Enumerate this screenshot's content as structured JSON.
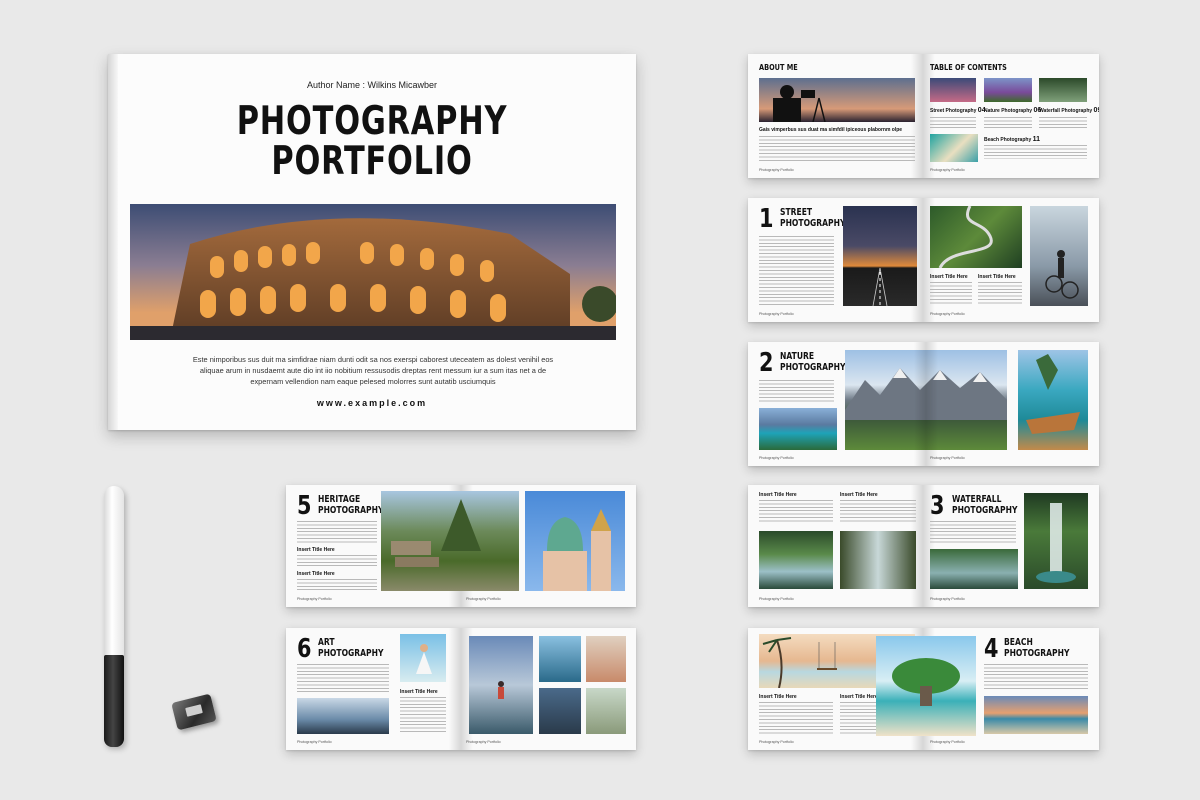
{
  "cover": {
    "author": "Author Name : Wilkins Micawber",
    "title_line1": "PHOTOGRAPHY",
    "title_line2": "PORTFOLIO",
    "body": "Este nimporibus sus duit ma simfidrae niam dunti odit sa nos exerspi caborest uteceatem as dolest venihil eos aliquae arum in nusdaemt aute dio int iio nobitium ressusodis dreptas rent messum iur a sum itas net a de expernam vellendion nam eaque pelesed molorres sunt autatib usciumquis",
    "url": "www.example.com"
  },
  "spreads": {
    "about": {
      "about_title": "ABOUT ME",
      "tagline": "Gais vimperbus sus duat ma simfdil ipiceous plabornm olpe",
      "toc_title": "TABLE OF CONTENTS",
      "toc": [
        {
          "label": "Street Photography",
          "page": "04"
        },
        {
          "label": "Nature Photography",
          "page": "06"
        },
        {
          "label": "Waterfall Photography",
          "page": "09"
        },
        {
          "label": "Beach Photography",
          "page": "11"
        }
      ],
      "footer_left": "Photography Portfolio",
      "footer_right": "Photography Portfolio"
    },
    "street": {
      "number": "1",
      "title_line1": "STREET",
      "title_line2": "PHOTOGRAPHY",
      "sub1": "Insert Title Here",
      "sub2": "Insert Title Here",
      "footer_left": "Photography Portfolio",
      "footer_right": "Photography Portfolio"
    },
    "nature": {
      "number": "2",
      "title_line1": "NATURE",
      "title_line2": "PHOTOGRAPHY",
      "footer_left": "Photography Portfolio",
      "footer_right": "Photography Portfolio"
    },
    "heritage": {
      "number": "5",
      "title_line1": "HERITAGE",
      "title_line2": "PHOTOGRAPHY",
      "sub1": "Insert Title Here",
      "sub2": "Insert Title Here",
      "footer_left": "Photography Portfolio",
      "footer_right": "Photography Portfolio"
    },
    "waterfall": {
      "number": "3",
      "title_line1": "WATERFALL",
      "title_line2": "PHOTOGRAPHY",
      "sub1": "Insert Title Here",
      "sub2": "Insert Title Here",
      "footer_left": "Photography Portfolio",
      "footer_right": "Photography Portfolio"
    },
    "art": {
      "number": "6",
      "title_line1": "ART",
      "title_line2": "PHOTOGRAPHY",
      "sub1": "Insert Title Here",
      "footer_left": "Photography Portfolio",
      "footer_right": "Photography Portfolio"
    },
    "beach": {
      "number": "4",
      "title_line1": "BEACH",
      "title_line2": "PHOTOGRAPHY",
      "sub1": "Insert Title Here",
      "sub2": "Insert Title Here",
      "footer_left": "Photography Portfolio",
      "footer_right": "Photography Portfolio"
    }
  }
}
